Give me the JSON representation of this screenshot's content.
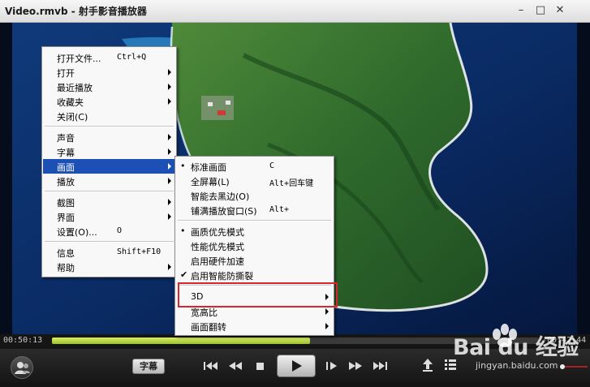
{
  "window": {
    "title": "Video.rmvb - 射手影音播放器",
    "controls": [
      "minimize",
      "maximize",
      "close"
    ]
  },
  "playback": {
    "elapsed": "00:50:13",
    "remaining": "-00:42:44",
    "progress": 0.53
  },
  "controls": {
    "subtitle_label": "字幕",
    "buttons": [
      "user-icon",
      "prev-icon",
      "rewind-icon",
      "stop-icon",
      "play-icon",
      "frame-step-icon",
      "fast-forward-icon",
      "next-icon",
      "upload-icon",
      "playlist-icon"
    ]
  },
  "watermark": {
    "logo": "Bai du 经验",
    "url": "jingyan.baidu.com"
  },
  "context_menu": {
    "items": [
      {
        "label": "打开文件...",
        "shortcut": "Ctrl+Q"
      },
      {
        "label": "打开",
        "submenu": true
      },
      {
        "label": "最近播放",
        "submenu": true
      },
      {
        "label": "收藏夹",
        "submenu": true
      },
      {
        "label": "关闭(C)"
      },
      {
        "label": "声音",
        "submenu": true
      },
      {
        "label": "字幕",
        "submenu": true
      },
      {
        "label": "画面",
        "submenu": true,
        "highlighted": true
      },
      {
        "label": "播放",
        "submenu": true
      },
      {
        "label": "截图",
        "submenu": true
      },
      {
        "label": "界面",
        "submenu": true
      },
      {
        "label": "设置(O)...",
        "shortcut": "O"
      },
      {
        "label": "信息",
        "shortcut": "Shift+F10"
      },
      {
        "label": "帮助",
        "submenu": true
      }
    ]
  },
  "submenu": {
    "items": [
      {
        "label": "标准画面",
        "shortcut": "C",
        "mark": "•"
      },
      {
        "label": "全屏幕(L)",
        "shortcut": "Alt+回车键"
      },
      {
        "label": "智能去黑边(O)"
      },
      {
        "label": "铺满播放窗口(S)",
        "shortcut": "Alt+"
      },
      {
        "label": "画质优先模式",
        "mark": "•"
      },
      {
        "label": "性能优先模式"
      },
      {
        "label": "启用硬件加速"
      },
      {
        "label": "启用智能防撕裂",
        "mark": "✔"
      },
      {
        "label": "3D",
        "submenu": true
      },
      {
        "label": "宽高比",
        "submenu": true
      },
      {
        "label": "画面翻转",
        "submenu": true
      }
    ]
  },
  "colors": {
    "accent": "#1d50b4",
    "progress": "#a8c93a",
    "annotation": "#d8262e"
  }
}
